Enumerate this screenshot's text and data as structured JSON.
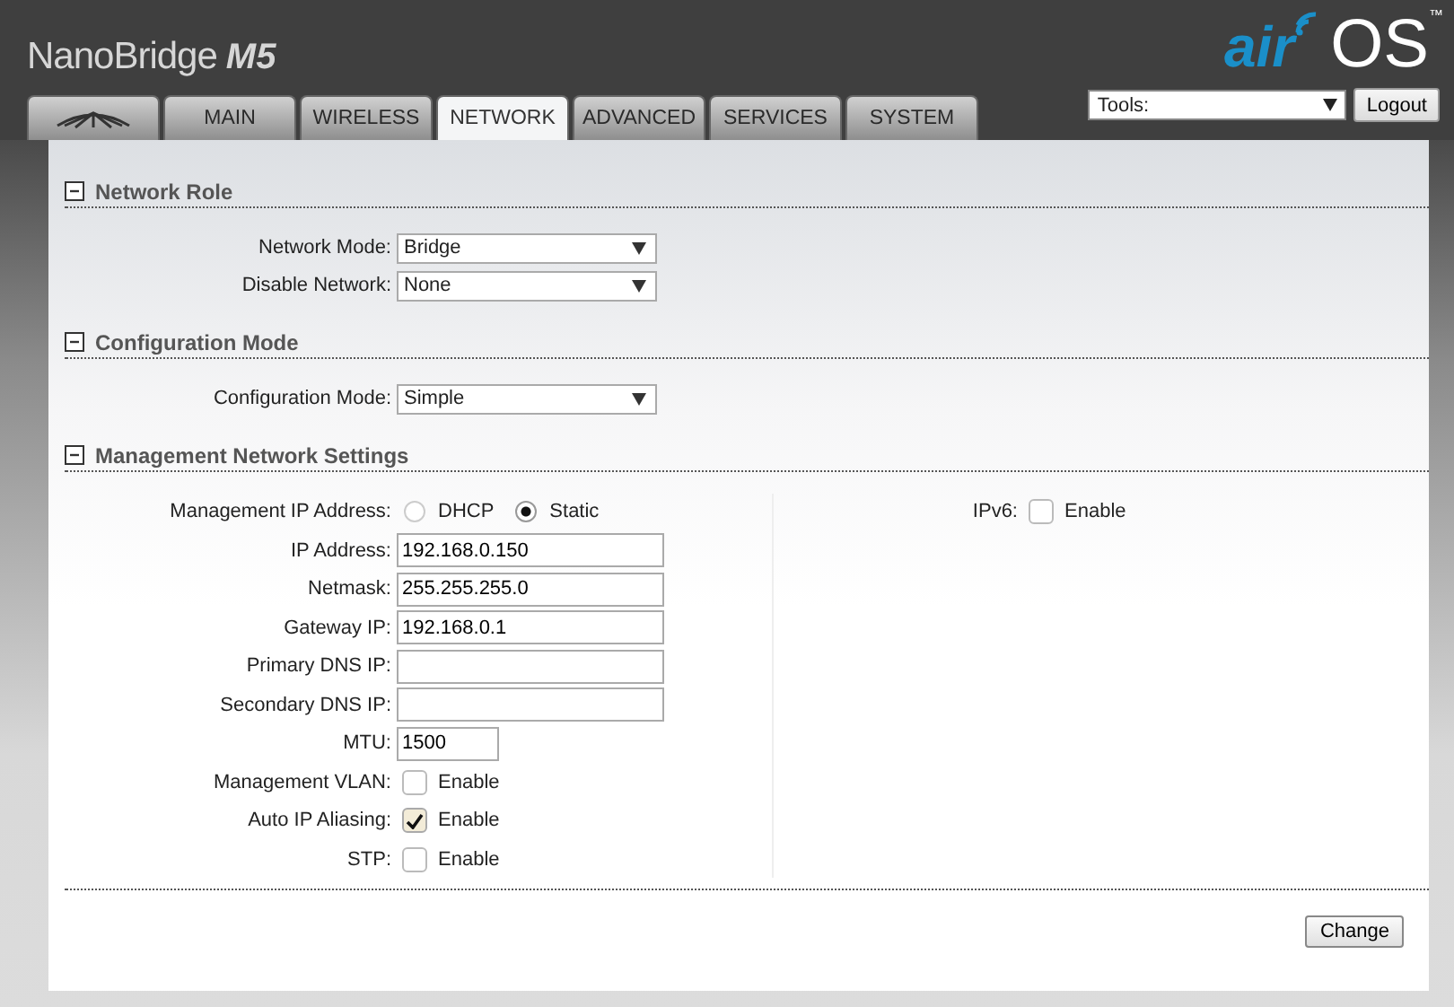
{
  "header": {
    "product": "NanoBridge",
    "model": "M5",
    "logo": {
      "prefix": "air",
      "suffix": "OS",
      "mark": "™"
    }
  },
  "tabs": [
    {
      "kind": "logo",
      "selected": false
    },
    {
      "kind": "text",
      "label": "MAIN",
      "selected": false
    },
    {
      "kind": "text",
      "label": "WIRELESS",
      "selected": false
    },
    {
      "kind": "text",
      "label": "NETWORK",
      "selected": true
    },
    {
      "kind": "text",
      "label": "ADVANCED",
      "selected": false
    },
    {
      "kind": "text",
      "label": "SERVICES",
      "selected": false
    },
    {
      "kind": "text",
      "label": "SYSTEM",
      "selected": false
    }
  ],
  "tools": {
    "value": "Tools:"
  },
  "logout": "Logout",
  "sections": [
    {
      "title": "Network Role",
      "expanded": true,
      "columns": [
        [
          {
            "kind": "select",
            "label": "Network Mode:",
            "value": "Bridge"
          },
          {
            "kind": "select",
            "label": "Disable Network:",
            "value": "None"
          }
        ]
      ]
    },
    {
      "title": "Configuration Mode",
      "expanded": true,
      "columns": [
        [
          {
            "kind": "select",
            "label": "Configuration Mode:",
            "value": "Simple"
          }
        ]
      ]
    },
    {
      "title": "Management Network Settings",
      "expanded": true,
      "columns": [
        [
          {
            "kind": "radio",
            "label": "Management IP Address:",
            "options": [
              {
                "label": "DHCP",
                "selected": false
              },
              {
                "label": "Static",
                "selected": true
              }
            ]
          },
          {
            "kind": "text",
            "label": "IP Address:",
            "value": "192.168.0.150"
          },
          {
            "kind": "text",
            "label": "Netmask:",
            "value": "255.255.255.0"
          },
          {
            "kind": "text",
            "label": "Gateway IP:",
            "value": "192.168.0.1"
          },
          {
            "kind": "text",
            "label": "Primary DNS IP:"
          },
          {
            "kind": "text",
            "label": "Secondary DNS IP:"
          },
          {
            "kind": "number",
            "label": "MTU:",
            "value": "1500"
          },
          {
            "kind": "checkbox",
            "label": "Management VLAN:",
            "option": "Enable",
            "checked": false
          },
          {
            "kind": "checkbox",
            "label": "Auto IP Aliasing:",
            "option": "Enable",
            "checked": true
          },
          {
            "kind": "checkbox",
            "label": "STP:",
            "option": "Enable",
            "checked": false
          }
        ],
        [
          {
            "kind": "checkbox",
            "label": "IPv6:",
            "option": "Enable",
            "checked": false
          }
        ]
      ]
    }
  ],
  "change_button": "Change"
}
